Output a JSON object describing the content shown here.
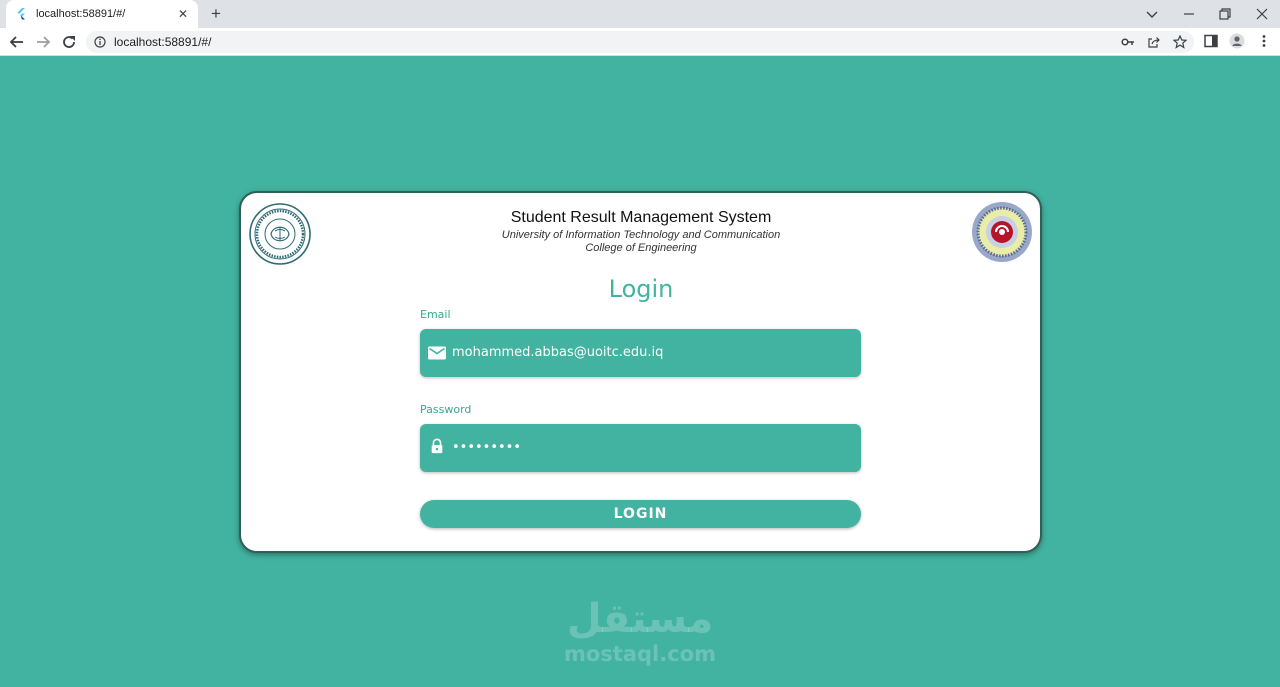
{
  "browser": {
    "tab_title": "localhost:58891/#/",
    "address": "localhost:58891/#/",
    "icons": [
      "flutter-favicon",
      "close-icon",
      "plus-icon",
      "chevron-down-icon",
      "minimize-icon",
      "restore-icon",
      "close-window-icon",
      "back-arrow-icon",
      "forward-arrow-icon",
      "reload-icon",
      "info-icon",
      "key-icon",
      "share-icon",
      "star-icon",
      "sidebar-icon",
      "profile-icon",
      "kebab-menu-icon"
    ]
  },
  "header": {
    "title": "Student Result Management System",
    "subtitle_1": "University of Information Technology and Communication",
    "subtitle_2": "College of Engineering"
  },
  "login": {
    "title": "Login",
    "email_label": "Email",
    "email_value": "mohammed.abbas@uoitc.edu.iq",
    "password_label": "Password",
    "password_value": "•••••••••",
    "button_label": "LOGIN"
  },
  "watermark": {
    "arabic": "مستقل",
    "latin": "mostaql.com"
  },
  "colors": {
    "background": "#42b3a1",
    "accent": "#42b3a1",
    "card": "#ffffff"
  }
}
